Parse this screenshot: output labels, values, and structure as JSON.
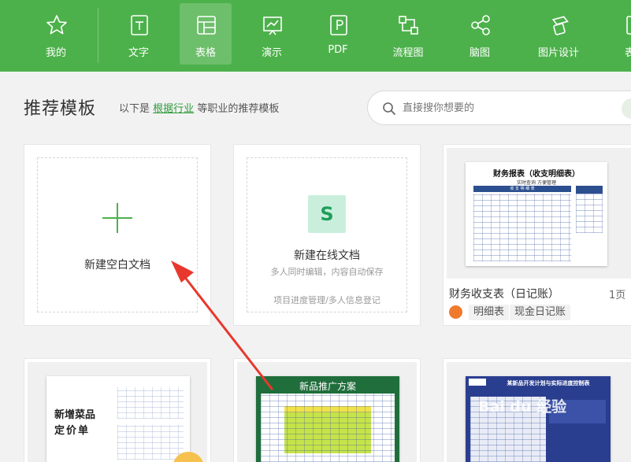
{
  "toolbar": {
    "items": [
      {
        "label": "我的",
        "icon": "star-icon"
      },
      {
        "label": "文字",
        "icon": "document-icon"
      },
      {
        "label": "表格",
        "icon": "spreadsheet-icon",
        "active": true
      },
      {
        "label": "演示",
        "icon": "presentation-icon"
      },
      {
        "label": "PDF",
        "icon": "pdf-icon"
      },
      {
        "label": "流程图",
        "icon": "flowchart-icon"
      },
      {
        "label": "脑图",
        "icon": "mindmap-icon"
      },
      {
        "label": "图片设计",
        "icon": "image-design-icon"
      },
      {
        "label": "表",
        "icon": "more-icon"
      }
    ],
    "bg_color": "#4db14b"
  },
  "section": {
    "title": "推荐模板",
    "subtitle_prefix": "以下是",
    "subtitle_link": "根据行业",
    "subtitle_suffix": "等职业的推荐模板"
  },
  "search": {
    "placeholder": "直接搜你想要的"
  },
  "cards": {
    "new_blank": {
      "label": "新建空白文档"
    },
    "new_online": {
      "label": "新建在线文档",
      "note1": "多人同时编辑，内容自动保存",
      "note2": "项目进度管理/多人信息登记",
      "icon_letter": "S"
    },
    "template1": {
      "name": "财务收支表（日记账）",
      "pages": "1页",
      "tags": [
        "明细表",
        "现金日记账"
      ],
      "thumb_title": "财务报表（收支明细表）",
      "thumb_subtitle": "实时查询 方便管理",
      "thumb_header": "收 支 明 细 表"
    },
    "template2": {
      "thumb_line1": "新增菜品",
      "thumb_line2": "定价单"
    },
    "template3": {
      "thumb_title": "新品推广方案"
    },
    "template4": {
      "thumb_title": "某新品开发计划与实际进度控制表"
    }
  },
  "watermark": "Bai du 经验",
  "accent_color": "#2f9b3b",
  "annotation_arrow_color": "#e8382d"
}
